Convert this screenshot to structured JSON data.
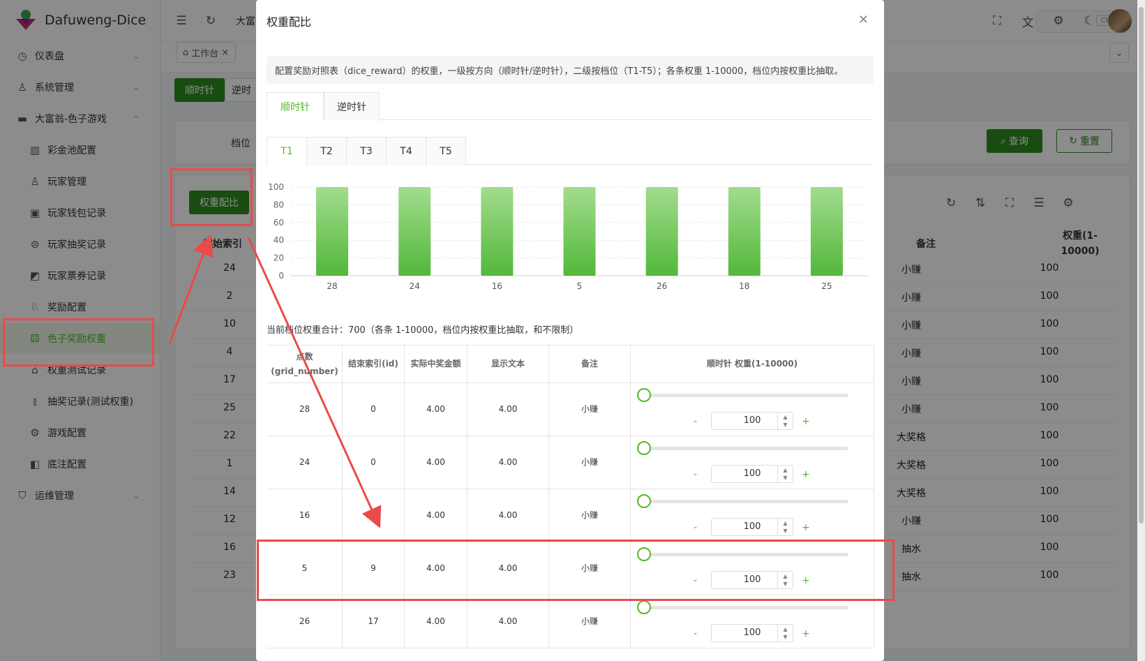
{
  "app": {
    "title": "Dafuweng-Dice"
  },
  "sidebar": {
    "items": [
      {
        "label": "仪表盘",
        "icon": "clock-icon"
      },
      {
        "label": "系统管理",
        "icon": "user-icon"
      },
      {
        "label": "大富翁-色子游戏",
        "icon": "gamepad-icon"
      },
      {
        "label": "彩金池配置",
        "icon": "chart-icon"
      },
      {
        "label": "玩家管理",
        "icon": "user-icon"
      },
      {
        "label": "玩家钱包记录",
        "icon": "wallet-icon"
      },
      {
        "label": "玩家抽奖记录",
        "icon": "receipt-icon"
      },
      {
        "label": "玩家票券记录",
        "icon": "ticket-icon"
      },
      {
        "label": "奖励配置",
        "icon": "award-icon"
      },
      {
        "label": "色子奖励权重",
        "icon": "dice-icon"
      },
      {
        "label": "权重测试记录",
        "icon": "home-icon"
      },
      {
        "label": "抽奖记录(测试权重)",
        "icon": "flask-icon"
      },
      {
        "label": "游戏配置",
        "icon": "gear-box-icon"
      },
      {
        "label": "底注配置",
        "icon": "stack-icon"
      },
      {
        "label": "运维管理",
        "icon": "shield-icon"
      }
    ]
  },
  "topbar": {
    "tab_partial": "大富",
    "search_shortcut": "Ctrl K"
  },
  "workbench": {
    "tab_label": "工作台"
  },
  "background": {
    "btn_clockwise": "顺时针",
    "btn_counter_partial": "逆时",
    "label_tier": "档位",
    "btn_query": "查询",
    "btn_reset": "重置",
    "btn_weight_ratio": "权重配比",
    "col_start": "起始索引",
    "col_note": "备注",
    "col_weight": "权重(1-\n10000)",
    "rows": [
      {
        "start": "24",
        "note": "小赚",
        "weight": "100"
      },
      {
        "start": "2",
        "note": "小赚",
        "weight": "100"
      },
      {
        "start": "10",
        "note": "小赚",
        "weight": "100"
      },
      {
        "start": "4",
        "note": "小赚",
        "weight": "100"
      },
      {
        "start": "17",
        "note": "小赚",
        "weight": "100"
      },
      {
        "start": "25",
        "note": "小赚",
        "weight": "100"
      },
      {
        "start": "22",
        "note": "大奖格",
        "weight": "100"
      },
      {
        "start": "1",
        "note": "大奖格",
        "weight": "100"
      },
      {
        "start": "14",
        "note": "大奖格",
        "weight": "100"
      },
      {
        "start": "12",
        "note": "小赚",
        "weight": "100"
      },
      {
        "start": "16",
        "note": "抽水",
        "weight": "100"
      },
      {
        "start": "23",
        "note": "抽水",
        "weight": "100"
      }
    ]
  },
  "modal": {
    "title": "权重配比",
    "close_icon": "close-icon",
    "info": "配置奖励对照表（dice_reward）的权重，一级按方向（顺时针/逆时针），二级按档位（T1-T5）；各条权重 1-10000，档位内按权重比抽取。",
    "direction_tabs": [
      "顺时针",
      "逆时针"
    ],
    "tier_tabs": [
      "T1",
      "T2",
      "T3",
      "T4",
      "T5"
    ],
    "summary": "当前档位权重合计：700（各条 1-10000，档位内按权重比抽取，和不限制）",
    "table_headers": {
      "grid_number": "点数\n(grid_number)",
      "end_index": "结束索引(id)",
      "real_amount": "实际中奖金额",
      "display_text": "显示文本",
      "note": "备注",
      "weight": "顺时针 权重(1-10000)"
    },
    "rows": [
      {
        "grid": "28",
        "end_id": "0",
        "real": "4.00",
        "display": "4.00",
        "note": "小赚",
        "weight": "100"
      },
      {
        "grid": "24",
        "end_id": "0",
        "real": "4.00",
        "display": "4.00",
        "note": "小赚",
        "weight": "100"
      },
      {
        "grid": "16",
        "end_id": "",
        "real": "4.00",
        "display": "4.00",
        "note": "小赚",
        "weight": "100"
      },
      {
        "grid": "5",
        "end_id": "9",
        "real": "4.00",
        "display": "4.00",
        "note": "小赚",
        "weight": "100"
      },
      {
        "grid": "26",
        "end_id": "17",
        "real": "4.00",
        "display": "4.00",
        "note": "小赚",
        "weight": "100"
      }
    ],
    "stepper_minus": "-",
    "stepper_plus": "+"
  },
  "colors": {
    "accent": "#52b82a",
    "primary_dark": "#2f8a1f",
    "annotation_red": "#ea4a4a"
  },
  "chart_data": {
    "type": "bar",
    "categories": [
      "28",
      "24",
      "16",
      "5",
      "26",
      "18",
      "25"
    ],
    "values": [
      100,
      100,
      100,
      100,
      100,
      100,
      100
    ],
    "ylim": [
      0,
      100
    ],
    "yticks": [
      "0",
      "20",
      "40",
      "60",
      "80",
      "100"
    ],
    "grid": true,
    "bar_color": "#5cc24a"
  }
}
